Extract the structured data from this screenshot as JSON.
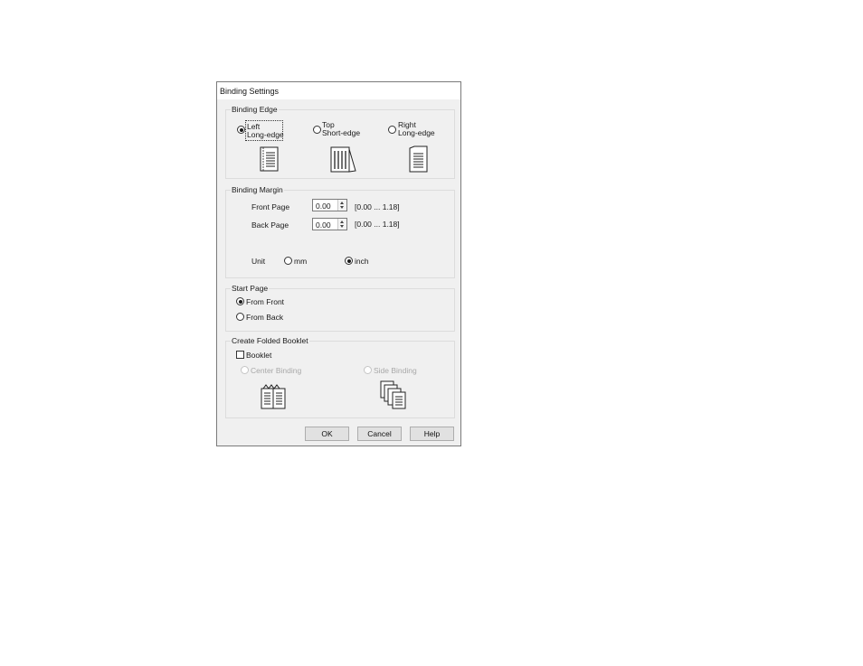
{
  "dialog": {
    "title": "Binding Settings"
  },
  "binding_edge": {
    "legend": "Binding Edge",
    "options": [
      {
        "line1": "Left",
        "line2": "Long-edge",
        "checked": true,
        "icon": "left-binding-icon"
      },
      {
        "line1": "Top",
        "line2": "Short-edge",
        "checked": false,
        "icon": "top-binding-icon"
      },
      {
        "line1": "Right",
        "line2": "Long-edge",
        "checked": false,
        "icon": "right-binding-icon"
      }
    ]
  },
  "binding_margin": {
    "legend": "Binding Margin",
    "front_page_label": "Front Page",
    "front_page_value": "0.00",
    "back_page_label": "Back Page",
    "back_page_value": "0.00",
    "range": "[0.00 ... 1.18]",
    "unit_label": "Unit",
    "unit_mm": "mm",
    "unit_inch": "inch",
    "unit_selected": "inch"
  },
  "start_page": {
    "legend": "Start Page",
    "from_front": "From Front",
    "from_back": "From Back",
    "selected": "From Front"
  },
  "folded_booklet": {
    "legend": "Create Folded Booklet",
    "booklet_label": "Booklet",
    "booklet_checked": false,
    "center_binding": "Center Binding",
    "side_binding": "Side Binding"
  },
  "buttons": {
    "ok": "OK",
    "cancel": "Cancel",
    "help": "Help"
  }
}
